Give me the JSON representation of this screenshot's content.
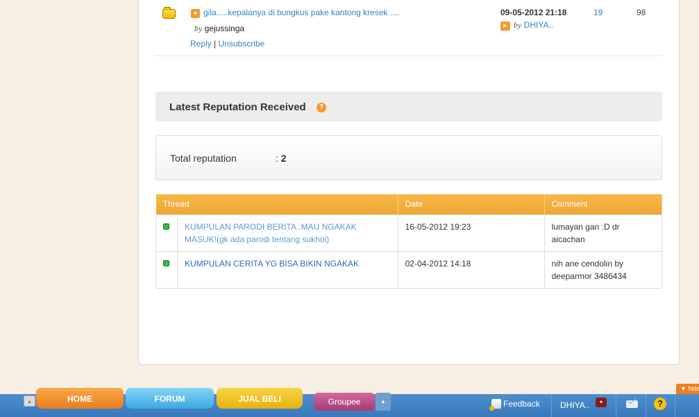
{
  "thread": {
    "title": "gila.....kepalanya di bungkus pake kantong kresek ....",
    "by_label": "by",
    "author": "gejussinga",
    "reply_label": "Reply",
    "separator": "|",
    "unsubscribe_label": "Unsubscribe",
    "last_post_date": "09-05-2012 21:18",
    "last_post_author": "DHIYA..",
    "replies": "19",
    "views": "98"
  },
  "reputation": {
    "header_title": "Latest Reputation Received",
    "help_symbol": "?",
    "total_label": "Total reputation",
    "total_prefix": ":",
    "total_value": "2",
    "columns": [
      "Thread",
      "Date",
      "Comment"
    ],
    "rows": [
      {
        "thread": "KUMPULAN PARODI BERITA..MAU NGAKAK MASUK!(gk ada parodi tentang sukhoi)",
        "date": "16-05-2012 19:23",
        "comment": "lumayan gan :D dr aicachan"
      },
      {
        "thread": "KUMPULAN CERITA YG BISA BIKIN NGAKAK",
        "date": "02-04-2012 14:18",
        "comment": "nih ane cendolin by deeparmor 3486434"
      }
    ]
  },
  "footer": {
    "tabs": {
      "home": "HOME",
      "forum": "FORUM",
      "jual_beli": "JUAL BELI",
      "groupee": "Groupee"
    },
    "feedback": "Feedback",
    "user": "DHIYA..",
    "help_symbol": "?",
    "hide_label": "hide"
  },
  "colors": {
    "link": "#2c84c8",
    "accent_orange": "#f39a2e",
    "table_header": "#f0aa37",
    "footer_bar": "#4282c4"
  }
}
